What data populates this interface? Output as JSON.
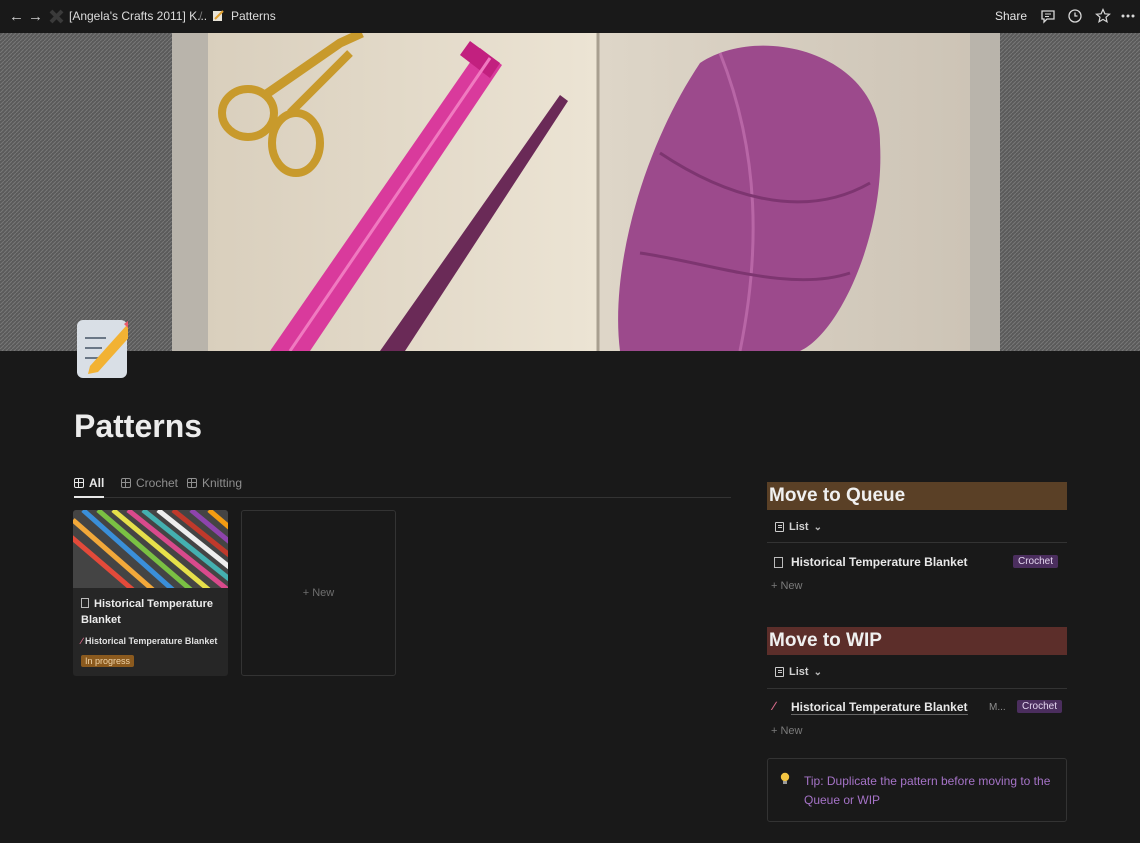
{
  "topbar": {
    "breadcrumb_workspace": "[Angela's Crafts 2011] K...",
    "breadcrumb_separator": "/",
    "breadcrumb_page": "Patterns",
    "share_label": "Share"
  },
  "page": {
    "title": "Patterns"
  },
  "tabs": [
    {
      "label": "All",
      "active": true
    },
    {
      "label": "Crochet",
      "active": false
    },
    {
      "label": "Knitting",
      "active": false
    }
  ],
  "gallery": {
    "card": {
      "title": "Historical Temperature Blanket",
      "relation": "Historical Temperature Blanket",
      "status": "In progress",
      "status_color": "#8b5a1e"
    },
    "new_label": "+ New"
  },
  "queue": {
    "heading": "Move to Queue",
    "heading_color": "#5a4026",
    "view_label": "List",
    "item_title": "Historical Temperature Blanket",
    "item_tag": "Crochet",
    "new_label": "+ New"
  },
  "wip": {
    "heading": "Move to WIP",
    "heading_color": "#5c2e2a",
    "view_label": "List",
    "item_title": "Historical Temperature Blanket",
    "item_extra": "M...",
    "item_tag": "Crochet",
    "new_label": "+ New"
  },
  "callout": {
    "text": "Tip: Duplicate the pattern before moving to the Queue or WIP",
    "text_color": "#a573c7"
  }
}
